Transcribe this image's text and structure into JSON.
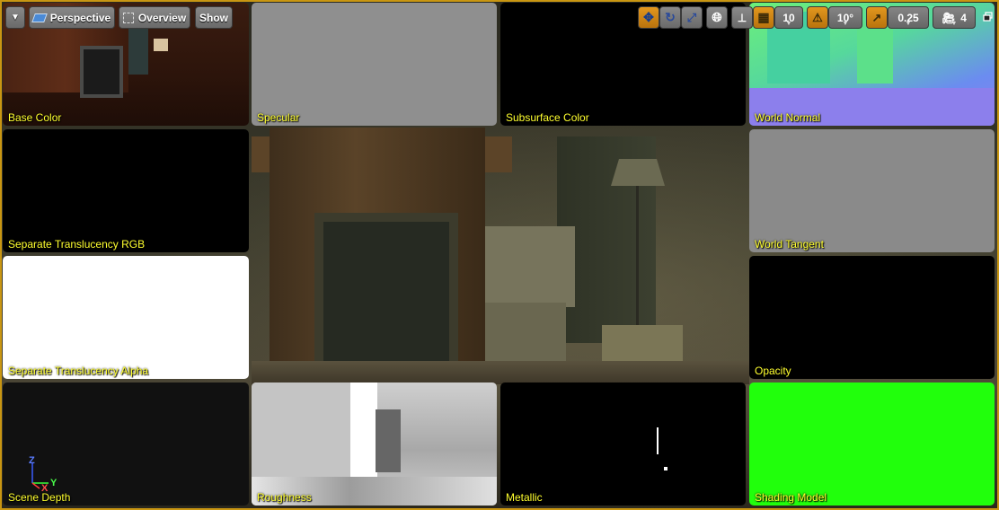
{
  "toolbar": {
    "menu_icon": "chevron-down-icon",
    "perspective_label": "Perspective",
    "overview_label": "Overview",
    "show_label": "Show",
    "grid_snap_value": "10",
    "rotation_snap_value": "10°",
    "scale_snap_value": "0.25",
    "camera_speed_value": "4"
  },
  "buffer_tiles": [
    {
      "label": "Base Color"
    },
    {
      "label": "Specular"
    },
    {
      "label": "Subsurface Color"
    },
    {
      "label": "World Normal"
    },
    {
      "label": "Separate Translucency RGB"
    },
    {
      "label": "World Tangent"
    },
    {
      "label": "Separate Translucency Alpha"
    },
    {
      "label": "Opacity"
    },
    {
      "label": "Scene Depth"
    },
    {
      "label": "Roughness"
    },
    {
      "label": "Metallic"
    },
    {
      "label": "Shading Model"
    }
  ],
  "axis": {
    "z": "Z",
    "x": "X",
    "y": "Y"
  },
  "colors": {
    "viewport_border": "#c99612",
    "label_text": "#ffff2e",
    "shading_model_fill": "#21ff0c",
    "toolbar_orange": "#e2971e"
  }
}
